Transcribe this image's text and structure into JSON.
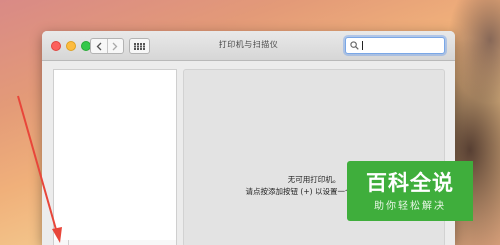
{
  "window": {
    "title": "打印机与扫描仪",
    "search": {
      "value": "",
      "placeholder": ""
    }
  },
  "main": {
    "empty_title": "无可用打印机。",
    "empty_hint": "请点按添加按钮 (+) 以设置一个打印机。"
  },
  "watermark": {
    "brand": "百科全说",
    "slogan": "助你轻松解决"
  },
  "annotation": {
    "arrow_color": "#e8463a"
  },
  "colors": {
    "watermark_green": "#3fae3c"
  }
}
